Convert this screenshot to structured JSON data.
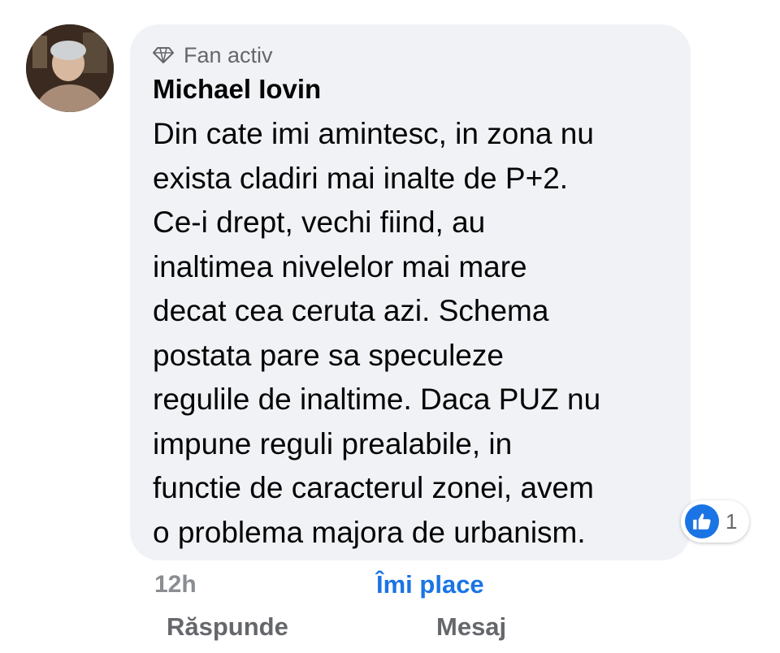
{
  "comment": {
    "badge_icon": "diamond-icon",
    "badge_label": "Fan activ",
    "author": "Michael Iovin",
    "text": "Din cate imi amintesc, in zona nu\nexista cladiri mai inalte de P+2.\nCe-i drept, vechi fiind, au\ninaltimea nivelelor mai mare\ndecat cea ceruta azi. Schema\npostata pare sa speculeze\nregulile de inaltime. Daca PUZ nu\nimpune reguli prealabile, in\nfunctie de caracterul zonei, avem\no problema majora de urbanism.",
    "reactions": {
      "icon": "like-icon",
      "count": "1",
      "color": "#1b74e4"
    },
    "timestamp": "12h"
  },
  "actions": {
    "like_label": "Îmi place",
    "reply_label": "Răspunde",
    "message_label": "Mesaj"
  },
  "colors": {
    "bubble_bg": "#f0f2f5",
    "accent": "#1b74e4",
    "secondary_text": "#65676b"
  }
}
